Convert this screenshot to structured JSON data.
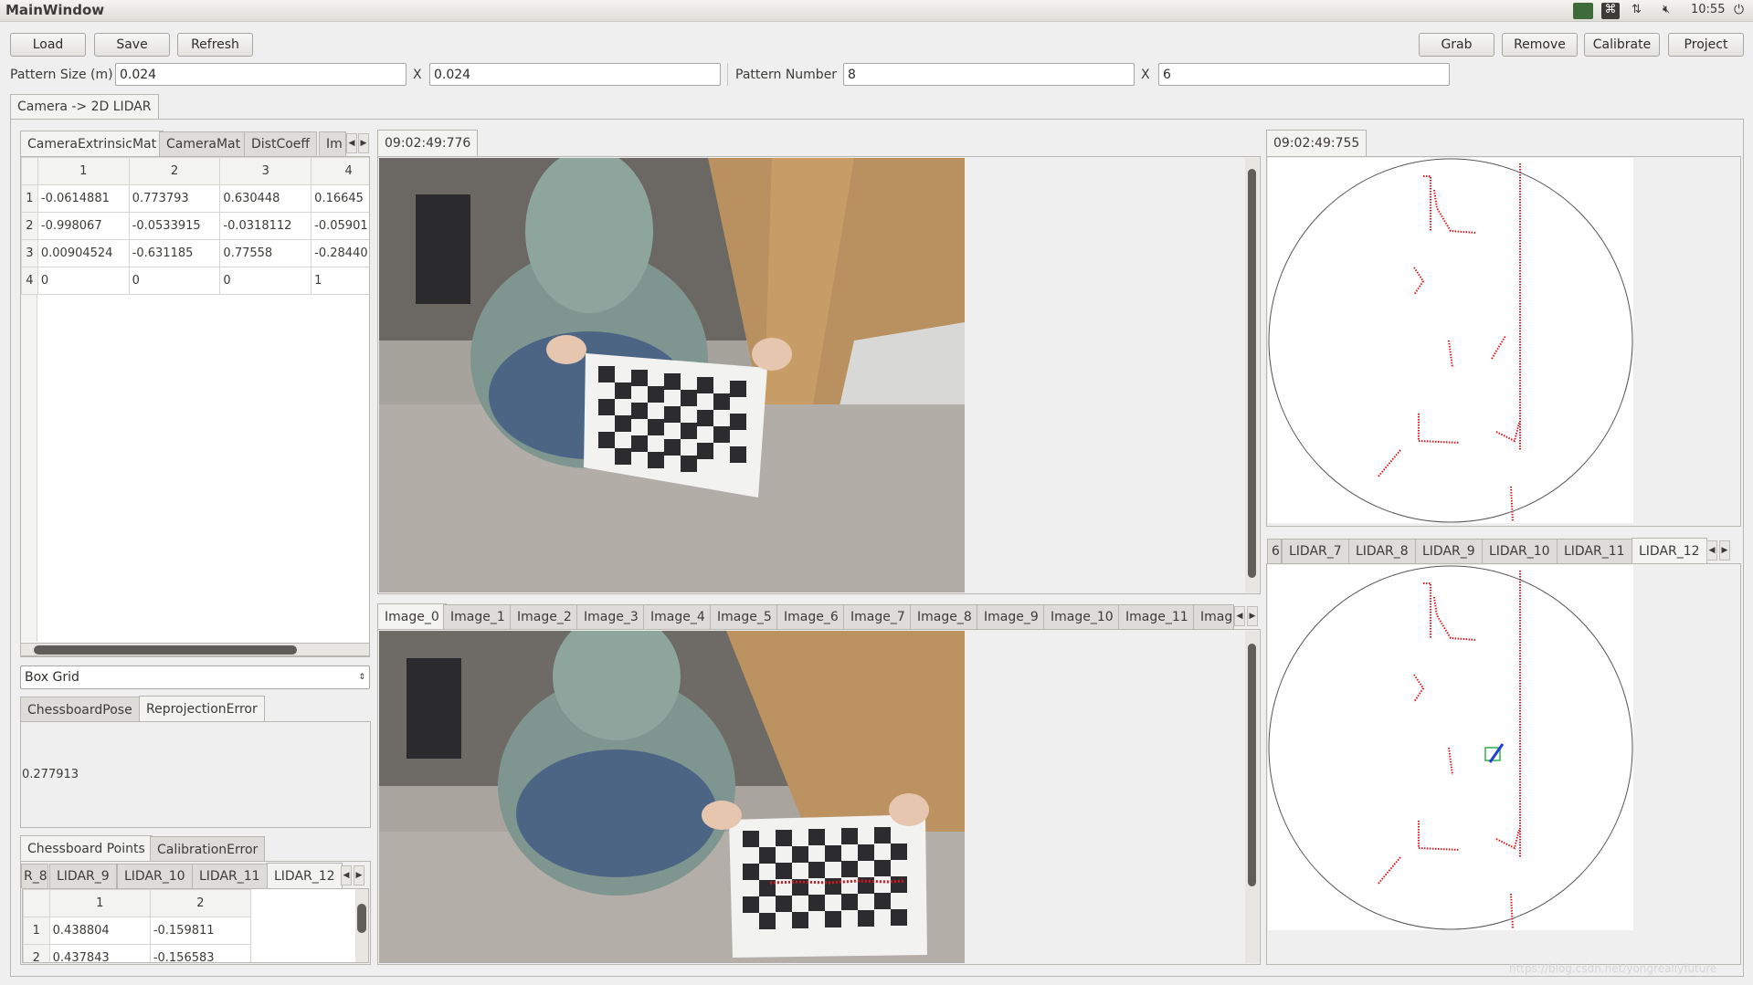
{
  "window": {
    "title": "MainWindow"
  },
  "tray": {
    "time": "10:55"
  },
  "toolbar": {
    "load": "Load",
    "save": "Save",
    "refresh": "Refresh",
    "grab": "Grab",
    "remove": "Remove",
    "calibrate": "Calibrate",
    "project": "Project"
  },
  "pattern": {
    "size_label": "Pattern Size (m)",
    "size_x": "0.024",
    "x_sep": "X",
    "size_y": "0.024",
    "number_label": "Pattern Number",
    "number_x": "8",
    "number_y": "6"
  },
  "main_tab": "Camera -> 2D LIDAR",
  "matrix_tabs": [
    "CameraExtrinsicMat",
    "CameraMat",
    "DistCoeff",
    "Im"
  ],
  "matrix": {
    "headers": [
      "1",
      "2",
      "3",
      "4"
    ],
    "rows": [
      {
        "index": "1",
        "cells": [
          "-0.0614881",
          "0.773793",
          "0.630448",
          "0.16645"
        ]
      },
      {
        "index": "2",
        "cells": [
          "-0.998067",
          "-0.0533915",
          "-0.0318112",
          "-0.05901"
        ]
      },
      {
        "index": "3",
        "cells": [
          "0.00904524",
          "-0.631185",
          "0.77558",
          "-0.28440"
        ]
      },
      {
        "index": "4",
        "cells": [
          "0",
          "0",
          "0",
          "1"
        ]
      }
    ]
  },
  "grid_select": "Box Grid",
  "pose_tabs": [
    "ChessboardPose",
    "ReprojectionError"
  ],
  "reprojection_error": "0.277913",
  "points_tabs": [
    "Chessboard Points",
    "CalibrationError"
  ],
  "lidar_subtabs": [
    "R_8",
    "LIDAR_9",
    "LIDAR_10",
    "LIDAR_11",
    "LIDAR_12"
  ],
  "points_table": {
    "headers": [
      "1",
      "2"
    ],
    "rows": [
      {
        "index": "1",
        "cells": [
          "0.438804",
          "-0.159811"
        ]
      },
      {
        "index": "2",
        "cells": [
          "0.437843",
          "-0.156583"
        ]
      }
    ]
  },
  "camera_timestamp": "09:02:49:776",
  "lidar_timestamp": "09:02:49:755",
  "image_tabs": [
    "Image_0",
    "Image_1",
    "Image_2",
    "Image_3",
    "Image_4",
    "Image_5",
    "Image_6",
    "Image_7",
    "Image_8",
    "Image_9",
    "Image_10",
    "Image_11",
    "Imag"
  ],
  "lidar_tabs": [
    "6",
    "LIDAR_7",
    "LIDAR_8",
    "LIDAR_9",
    "LIDAR_10",
    "LIDAR_11",
    "LIDAR_12"
  ],
  "watermark": "https://blog.csdn.net/yongreallyfuture",
  "colors": {
    "lidar_points": "#e0141c",
    "selection": "#1f3fd8",
    "selection_box": "#2bb24a"
  }
}
